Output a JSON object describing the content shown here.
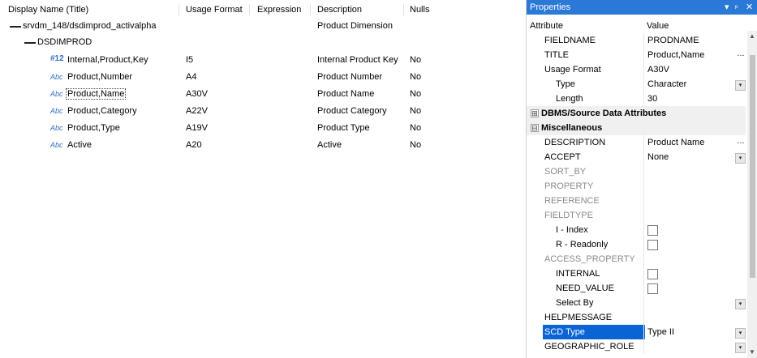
{
  "tree": {
    "columns": [
      "Display Name (Title)",
      "Usage Format",
      "Expression",
      "Description",
      "Nulls"
    ],
    "root": {
      "label": "srvdm_148/dsdimprod_activalpha",
      "description": "Product Dimension"
    },
    "segment": {
      "label": "DSDIMPROD"
    },
    "fields": [
      {
        "icon": "#12",
        "label": "Internal,Product,Key",
        "format": "I5",
        "description": "Internal Product Key",
        "nulls": "No"
      },
      {
        "icon": "Abc",
        "label": "Product,Number",
        "format": "A4",
        "description": "Product Number",
        "nulls": "No"
      },
      {
        "icon": "Abc",
        "label": "Product,Name",
        "format": "A30V",
        "description": "Product Name",
        "nulls": "No"
      },
      {
        "icon": "Abc",
        "label": "Product,Category",
        "format": "A22V",
        "description": "Product Category",
        "nulls": "No"
      },
      {
        "icon": "Abc",
        "label": "Product,Type",
        "format": "A19V",
        "description": "Product Type",
        "nulls": "No"
      },
      {
        "icon": "Abc",
        "label": "Active",
        "format": "A20",
        "description": "Active",
        "nulls": "No"
      }
    ]
  },
  "properties": {
    "title": "Properties",
    "controls": {
      "pin": "ᵖ",
      "dropdown": "▾",
      "close": "✕"
    },
    "header": {
      "attribute": "Attribute",
      "value": "Value"
    },
    "rows": [
      {
        "name": "FIELDNAME",
        "value": "PRODNAME"
      },
      {
        "name": "TITLE",
        "value": "Product,Name"
      },
      {
        "name": "Usage Format",
        "value": "A30V"
      },
      {
        "name": "Type",
        "value": "Character"
      },
      {
        "name": "Length",
        "value": "30"
      },
      {
        "name": "DBMS/Source Data Attributes",
        "value": "",
        "category": true,
        "toggle": "⊞"
      },
      {
        "name": "Miscellaneous",
        "value": "",
        "category": true,
        "toggle": "⊟"
      },
      {
        "name": "DESCRIPTION",
        "value": "Product Name"
      },
      {
        "name": "ACCEPT",
        "value": "None"
      },
      {
        "name": "SORT_BY",
        "value": ""
      },
      {
        "name": "PROPERTY",
        "value": ""
      },
      {
        "name": "REFERENCE",
        "value": ""
      },
      {
        "name": "FIELDTYPE",
        "value": ""
      },
      {
        "name": "I - Index",
        "value": ""
      },
      {
        "name": "R - Readonly",
        "value": ""
      },
      {
        "name": "ACCESS_PROPERTY",
        "value": ""
      },
      {
        "name": "INTERNAL",
        "value": ""
      },
      {
        "name": "NEED_VALUE",
        "value": ""
      },
      {
        "name": "Select By",
        "value": ""
      },
      {
        "name": "HELPMESSAGE",
        "value": ""
      },
      {
        "name": "SCD Type",
        "value": "Type II"
      },
      {
        "name": "GEOGRAPHIC_ROLE",
        "value": ""
      }
    ],
    "ellipsis": "...",
    "dropdown_arrow": "▾",
    "scroll_up": "▲",
    "scroll_down": "▼"
  },
  "colors": {
    "accent": "#2b79d6",
    "selection": "#0a64d6",
    "icon": "#2f6fc4"
  }
}
